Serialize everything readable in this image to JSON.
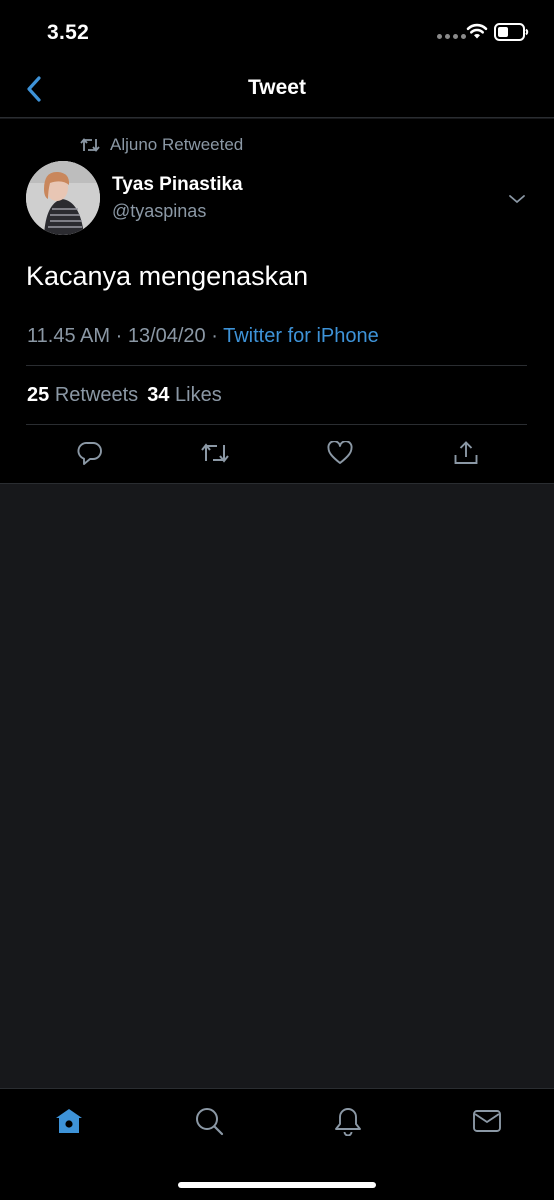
{
  "status_bar": {
    "time": "3.52"
  },
  "header": {
    "title": "Tweet"
  },
  "tweet": {
    "retweet_context": "Aljuno Retweeted",
    "author_name": "Tyas Pinastika",
    "author_handle": "@tyaspinas",
    "text": "Kacanya mengenaskan",
    "time": "11.45 AM",
    "date": "13/04/20",
    "separator": "·",
    "source": "Twitter for iPhone",
    "retweets_count": "25",
    "retweets_label": "Retweets",
    "likes_count": "34",
    "likes_label": "Likes"
  },
  "icons": {
    "back": "chevron-left-icon",
    "retweet_context": "retweet-icon",
    "more": "chevron-down-icon",
    "reply": "reply-icon",
    "retweet": "retweet-icon",
    "like": "heart-icon",
    "share": "share-icon",
    "tabs": [
      "home-icon",
      "search-icon",
      "bell-icon",
      "mail-icon"
    ]
  },
  "colors": {
    "background": "#000000",
    "empty_area": "#17181b",
    "accent": "#3e93d8",
    "secondary_text": "#8b98a5",
    "divider": "#2a2d31"
  }
}
